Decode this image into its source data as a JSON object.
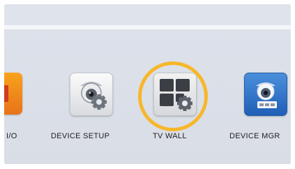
{
  "launcher": {
    "items": [
      {
        "key": "io",
        "label": "I/O",
        "icon": "io-icon"
      },
      {
        "key": "device_setup",
        "label": "DEVICE SETUP",
        "icon": "camera-gear-icon"
      },
      {
        "key": "tv_wall",
        "label": "TV WALL",
        "icon": "video-wall-gear-icon"
      },
      {
        "key": "device_mgr",
        "label": "DEVICE MGR",
        "icon": "camera-manager-icon"
      }
    ],
    "highlighted_item": "TV WALL",
    "highlight_color": "#f7b72a"
  }
}
